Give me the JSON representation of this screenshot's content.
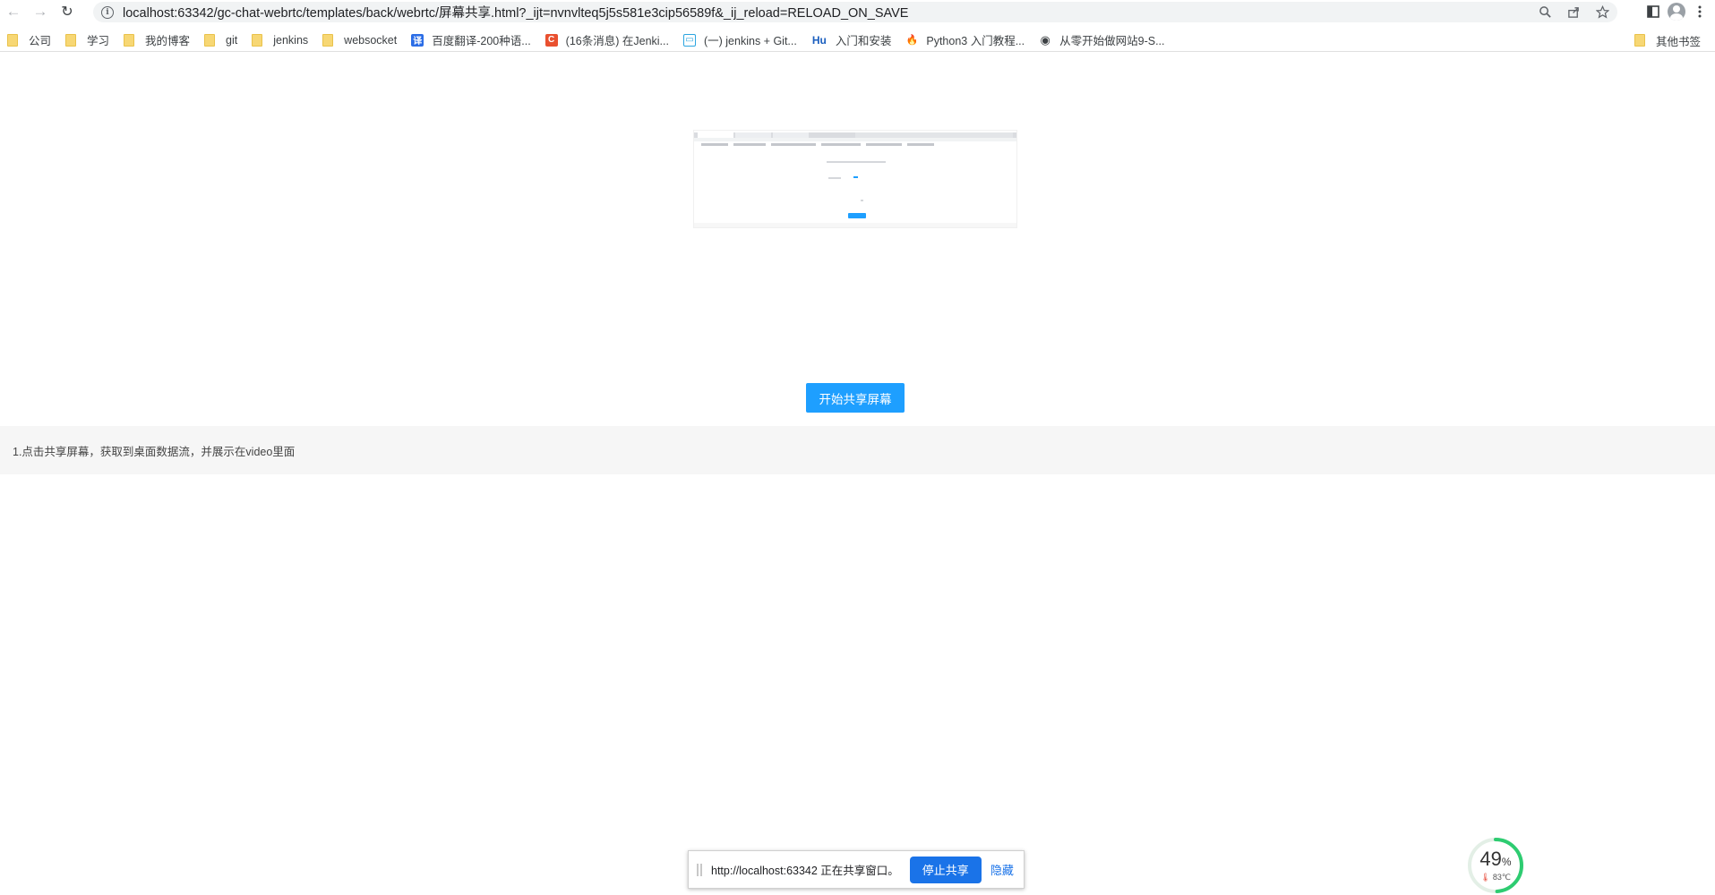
{
  "browser": {
    "url": "localhost:63342/gc-chat-webrtc/templates/back/webrtc/屏幕共享.html?_ijt=nvnvlteq5j5s581e3cip56589f&_ij_reload=RELOAD_ON_SAVE",
    "nav_back_icon": "←",
    "nav_forward_icon": "→",
    "reload_icon": "↻"
  },
  "bookmarks": {
    "items": [
      {
        "label": "公司",
        "icon": "folder-icon"
      },
      {
        "label": "学习",
        "icon": "folder-icon"
      },
      {
        "label": "我的博客",
        "icon": "folder-icon"
      },
      {
        "label": "git",
        "icon": "folder-icon"
      },
      {
        "label": "jenkins",
        "icon": "folder-icon"
      },
      {
        "label": "websocket",
        "icon": "folder-icon"
      },
      {
        "label": "百度翻译-200种语...",
        "icon": "translate-icon",
        "glyph": "译",
        "color": "#2b6de6"
      },
      {
        "label": "(16条消息) 在Jenki...",
        "icon": "csdn-icon",
        "glyph": "C",
        "color": "#e9502f"
      },
      {
        "label": "(一) jenkins + Git...",
        "icon": "bilibili-icon",
        "glyph": "▭",
        "color": "#2ba5e0"
      },
      {
        "label": "入门和安装",
        "icon": "hu-icon",
        "glyph": "Hu",
        "color": "#1b5fbf"
      },
      {
        "label": "Python3 入门教程...",
        "icon": "flame-icon",
        "glyph": "🔥",
        "color": "#ffffff"
      },
      {
        "label": "从零开始做网站9-S...",
        "icon": "globe-icon",
        "glyph": "◉",
        "color": "#ffffff"
      }
    ],
    "other": "其他书签"
  },
  "main": {
    "start_button": "开始共享屏幕",
    "note": "1.点击共享屏幕，获取到桌面数据流，并展示在video里面"
  },
  "share_bar": {
    "message": "http://localhost:63342 正在共享窗口。",
    "stop_button": "停止共享",
    "hide_link": "隐藏"
  },
  "cpu_widget": {
    "percent": "49",
    "percent_unit": "%",
    "percent_value": 49,
    "temperature": "83℃",
    "ring_color": "#2ecc71"
  }
}
